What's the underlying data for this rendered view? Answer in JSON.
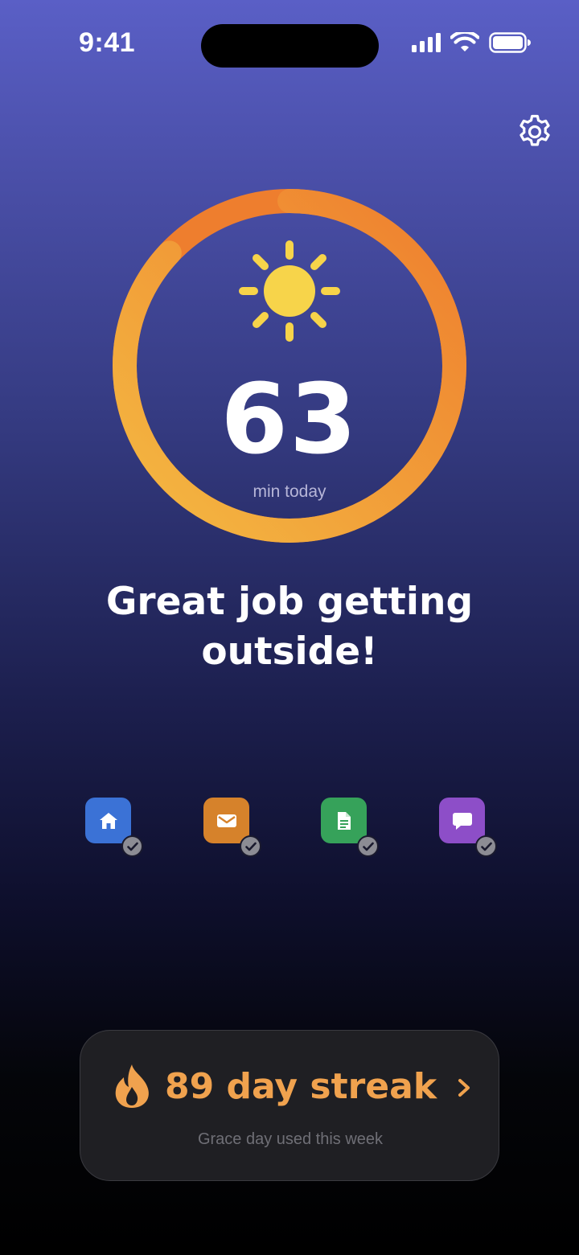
{
  "status_bar": {
    "time": "9:41",
    "icons": [
      "cellular-signal-icon",
      "wifi-icon",
      "battery-icon"
    ]
  },
  "settings": {
    "icon": "gear-icon"
  },
  "progress": {
    "minutes": "63",
    "label": "min today",
    "fraction": 0.87,
    "icon": "sun-icon",
    "colors": {
      "start": "#f4b942",
      "end": "#ee7e2e",
      "sun": "#f7d44a"
    }
  },
  "headline": "Great job getting outside!",
  "apps": [
    {
      "name": "home",
      "icon": "home-icon",
      "color": "#3b72d6",
      "checked": true
    },
    {
      "name": "mail",
      "icon": "mail-icon",
      "color": "#d6822b",
      "checked": true
    },
    {
      "name": "document",
      "icon": "document-icon",
      "color": "#36a25a",
      "checked": true
    },
    {
      "name": "messages",
      "icon": "message-icon",
      "color": "#8d4ec8",
      "checked": true
    }
  ],
  "streak": {
    "text": "89 day streak",
    "subtext": "Grace day used this week",
    "icon": "flame-icon",
    "color": "#f0a24e"
  }
}
